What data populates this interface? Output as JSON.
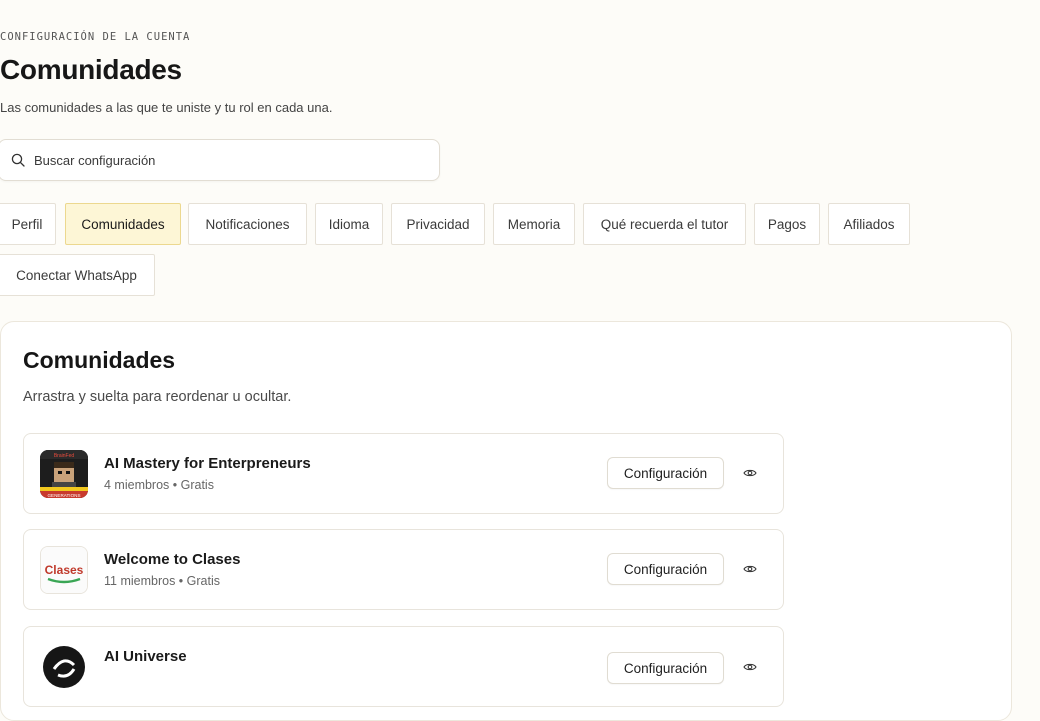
{
  "header": {
    "eyebrow": "CONFIGURACIÓN DE LA CUENTA",
    "title": "Comunidades",
    "subtitle": "Las comunidades a las que te uniste y tu rol en cada una."
  },
  "search": {
    "placeholder": "Buscar configuración",
    "icon": "search-icon"
  },
  "tabs": [
    {
      "label": "Perfil",
      "active": false
    },
    {
      "label": "Comunidades",
      "active": true
    },
    {
      "label": "Notificaciones",
      "active": false
    },
    {
      "label": "Idioma",
      "active": false
    },
    {
      "label": "Privacidad",
      "active": false
    },
    {
      "label": "Memoria",
      "active": false
    },
    {
      "label": "Qué recuerda el tutor",
      "active": false
    },
    {
      "label": "Pagos",
      "active": false
    },
    {
      "label": "Afiliados",
      "active": false
    },
    {
      "label": "Conectar WhatsApp",
      "active": false
    }
  ],
  "section": {
    "title": "Comunidades",
    "description": "Arrastra y suelta para reordenar u ocultar."
  },
  "communities": [
    {
      "name": "AI Mastery for Enterpreneurs",
      "meta": "4 miembros • Gratis",
      "settings_label": "Configuración",
      "thumb_text": "GENERATIONS",
      "thumb_header": "BrainFed"
    },
    {
      "name": "Welcome to Clases",
      "meta": "11 miembros • Gratis",
      "settings_label": "Configuración",
      "thumb_text": "Clases"
    },
    {
      "name": "AI Universe",
      "meta": "",
      "settings_label": "Configuración"
    }
  ],
  "colors": {
    "background": "#fdfcf8",
    "active_tab_bg": "#fdf6d6",
    "active_tab_border": "#ecd88f"
  }
}
